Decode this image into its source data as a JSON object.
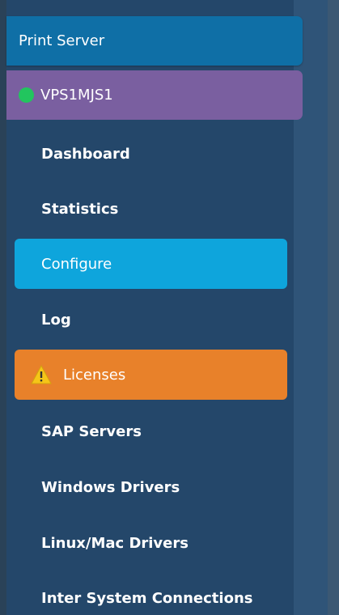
{
  "sidebar": {
    "header": {
      "label": "Print Server",
      "color": "#0f6fa6"
    },
    "server": {
      "name": "VPS1MJS1",
      "status_color": "#22c55e",
      "color": "#7a5fa0"
    },
    "items": [
      {
        "label": "Dashboard"
      },
      {
        "label": "Statistics"
      },
      {
        "label": "Configure",
        "state": "active"
      },
      {
        "label": "Log"
      },
      {
        "label": "Licenses",
        "state": "warning",
        "icon": "warning-icon"
      },
      {
        "label": "SAP Servers"
      },
      {
        "label": "Windows Drivers"
      },
      {
        "label": "Linux/Mac Drivers"
      },
      {
        "label": "Inter System Connections"
      }
    ],
    "colors": {
      "background": "#24476a",
      "active": "#0ea5dc",
      "warning": "#e8812a"
    }
  }
}
